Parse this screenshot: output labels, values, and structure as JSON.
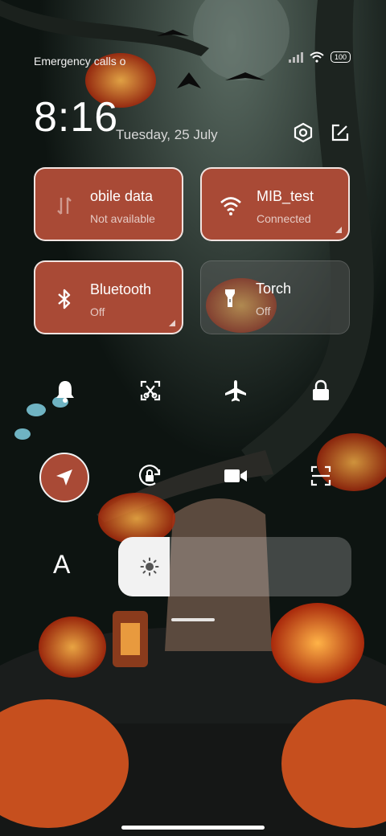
{
  "status_bar": {
    "left_text": "Emergency calls o",
    "battery": "100"
  },
  "header": {
    "time": "8:16",
    "date": "Tuesday, 25 July"
  },
  "tiles": [
    {
      "title": "obile data",
      "subtitle": "Not available",
      "state": "on"
    },
    {
      "title": "MIB_test",
      "subtitle": "Connected",
      "state": "on"
    },
    {
      "title": "Bluetooth",
      "subtitle": "Off",
      "state": "on"
    },
    {
      "title": "Torch",
      "subtitle": "Off",
      "state": "off"
    }
  ],
  "quick_icons_row1": [
    "bell-icon",
    "screenshot-icon",
    "airplane-icon",
    "lock-icon"
  ],
  "quick_icons_row2": [
    "location-icon",
    "rotation-lock-icon",
    "video-icon",
    "scan-icon"
  ],
  "font_size_label": "A",
  "brightness": {
    "level": 0.22
  },
  "colors": {
    "accent": "#a94a36",
    "tile_off": "#6e6e6e"
  }
}
